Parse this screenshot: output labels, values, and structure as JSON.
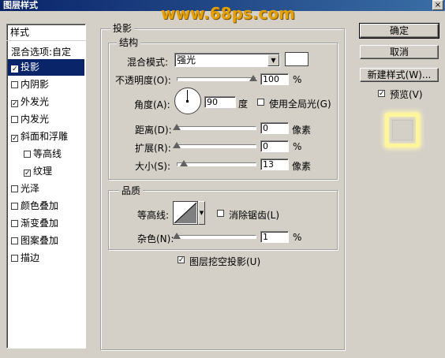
{
  "window": {
    "title": "图层样式",
    "close_glyph": "×"
  },
  "watermark": "www.68ps.com",
  "sidebar": {
    "header": "样式",
    "blend_options": "混合选项:自定",
    "items": [
      {
        "label": "投影",
        "checked": true,
        "active": true
      },
      {
        "label": "内阴影",
        "checked": false
      },
      {
        "label": "外发光",
        "checked": true
      },
      {
        "label": "内发光",
        "checked": false
      },
      {
        "label": "斜面和浮雕",
        "checked": true
      },
      {
        "label": "等高线",
        "checked": false,
        "indent": true
      },
      {
        "label": "纹理",
        "checked": true,
        "indent": true
      },
      {
        "label": "光泽",
        "checked": false
      },
      {
        "label": "颜色叠加",
        "checked": false
      },
      {
        "label": "渐变叠加",
        "checked": false
      },
      {
        "label": "图案叠加",
        "checked": false
      },
      {
        "label": "描边",
        "checked": false
      }
    ]
  },
  "panel": {
    "title": "投影",
    "structure": {
      "title": "结构",
      "blend_mode_label": "混合模式:",
      "blend_mode_value": "强光",
      "opacity_label": "不透明度(O):",
      "opacity_value": "100",
      "opacity_unit": "%",
      "angle_label": "角度(A):",
      "angle_value": "90",
      "angle_unit": "度",
      "global_light_label": "使用全局光(G)",
      "distance_label": "距离(D):",
      "distance_value": "0",
      "distance_unit": "像素",
      "spread_label": "扩展(R):",
      "spread_value": "0",
      "spread_unit": "%",
      "size_label": "大小(S):",
      "size_value": "13",
      "size_unit": "像素"
    },
    "quality": {
      "title": "品质",
      "contour_label": "等高线:",
      "anti_alias_label": "消除锯齿(L)",
      "noise_label": "杂色(N):",
      "noise_value": "1",
      "noise_unit": "%"
    },
    "knockout_label": "图层挖空投影(U)"
  },
  "buttons": {
    "ok": "确定",
    "cancel": "取消",
    "new_style": "新建样式(W)...",
    "preview_label": "预览(V)"
  },
  "colors": {
    "shadow_swatch": "#ffffff",
    "selection": "#0a246a",
    "dialog_bg": "#d4d0c8"
  }
}
